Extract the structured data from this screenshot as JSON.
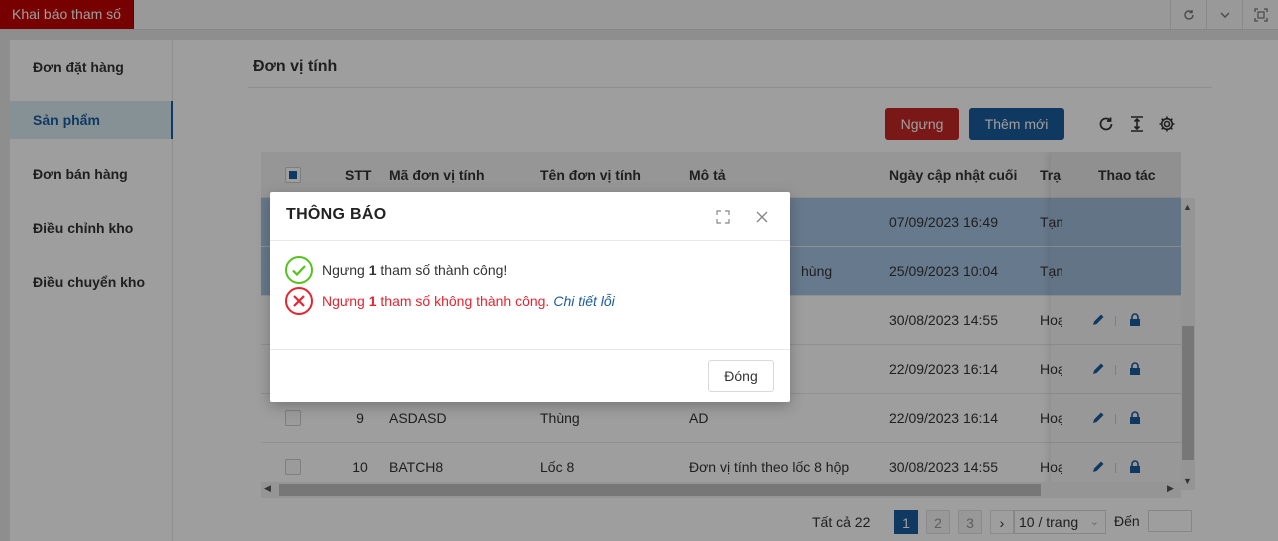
{
  "window": {
    "tab_label": "Khai báo tham số",
    "icons": [
      "refresh-icon",
      "chevron-down-icon",
      "fullscreen-icon"
    ]
  },
  "sidebar": {
    "items": [
      {
        "label": "Đơn đặt hàng",
        "active": false
      },
      {
        "label": "Sản phẩm",
        "active": true
      },
      {
        "label": "Đơn bán hàng",
        "active": false
      },
      {
        "label": "Điều chỉnh kho",
        "active": false
      },
      {
        "label": "Điều chuyển kho",
        "active": false
      }
    ]
  },
  "main": {
    "title": "Đơn vị tính",
    "stop_label": "Ngưng",
    "add_label": "Thêm mới",
    "colors": {
      "primary": "#1a5c9e",
      "danger": "#c62828",
      "selected_row": "#a7c4e2"
    }
  },
  "table": {
    "columns": [
      "STT",
      "Mã đơn vị tính",
      "Tên đơn vị tính",
      "Mô tả",
      "Ngày cập nhật cuối",
      "Trạ",
      "Thao tác"
    ],
    "rows": [
      {
        "stt": "",
        "code": "",
        "name": "",
        "desc": "",
        "date": "07/09/2023 16:49",
        "status": "Tạm",
        "selected": true,
        "actions": false
      },
      {
        "stt": "",
        "code": "",
        "name": "",
        "desc": "hùng",
        "date": "25/09/2023 10:04",
        "status": "Tạm",
        "selected": true,
        "actions": false
      },
      {
        "stt": "",
        "code": "",
        "name": "",
        "desc": "",
        "date": "30/08/2023 14:55",
        "status": "Hoạ",
        "selected": false,
        "actions": true
      },
      {
        "stt": "",
        "code": "",
        "name": "",
        "desc": "",
        "date": "22/09/2023 16:14",
        "status": "Hoạ",
        "selected": false,
        "actions": true
      },
      {
        "stt": "9",
        "code": "ASDASD",
        "name": "Thùng",
        "desc": "AD",
        "date": "22/09/2023 16:14",
        "status": "Hoạ",
        "selected": false,
        "actions": true
      },
      {
        "stt": "10",
        "code": "BATCH8",
        "name": "Lốc 8",
        "desc": "Đơn vị tính theo lốc 8 hộp",
        "date": "30/08/2023 14:55",
        "status": "Hoạ",
        "selected": false,
        "actions": true
      }
    ]
  },
  "pagination": {
    "total_label": "Tất cả 22",
    "pages": [
      "1",
      "2",
      "3"
    ],
    "current_page": "1",
    "next_symbol": "›",
    "page_size": "10 / trang",
    "goto_label": "Đến"
  },
  "dialog": {
    "title": "THÔNG BÁO",
    "success": {
      "prefix": "Ngưng ",
      "count": "1",
      "suffix": " tham số thành công!"
    },
    "error": {
      "prefix": "Ngưng ",
      "count": "1",
      "suffix": " tham số không thành công. ",
      "link": "Chi tiết lỗi"
    },
    "close_label": "Đóng",
    "colors": {
      "success": "#52c41a",
      "error": "#e8232f",
      "link": "#1a5c9e"
    }
  }
}
